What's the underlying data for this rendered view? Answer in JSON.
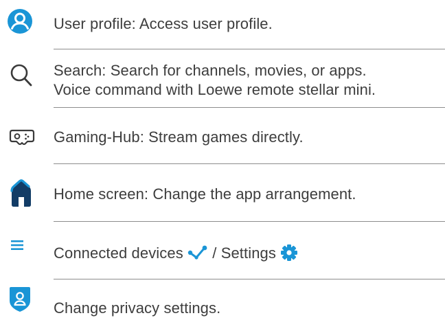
{
  "items": [
    {
      "icon": "user-profile-icon",
      "text": "User profile: Access user profile."
    },
    {
      "icon": "search-icon",
      "line1": "Search: Search for channels, movies, or apps.",
      "line2": "Voice command with Loewe remote stellar mini."
    },
    {
      "icon": "gamepad-icon",
      "text": "Gaming-Hub: Stream games directly."
    },
    {
      "icon": "home-icon",
      "text": "Home screen: Change the app arrangement."
    },
    {
      "icon": "menu-icon",
      "text_before": "Connected devices",
      "text_middle": "/ Settings",
      "inline_icons": [
        "connected-devices-icon",
        "settings-gear-icon"
      ]
    },
    {
      "icon": "privacy-shield-icon",
      "text": "Change privacy settings."
    }
  ],
  "colors": {
    "accent": "#1a95d6",
    "home_dark": "#123c66",
    "text": "#3d3d3d",
    "divider": "#8c8c8c"
  }
}
